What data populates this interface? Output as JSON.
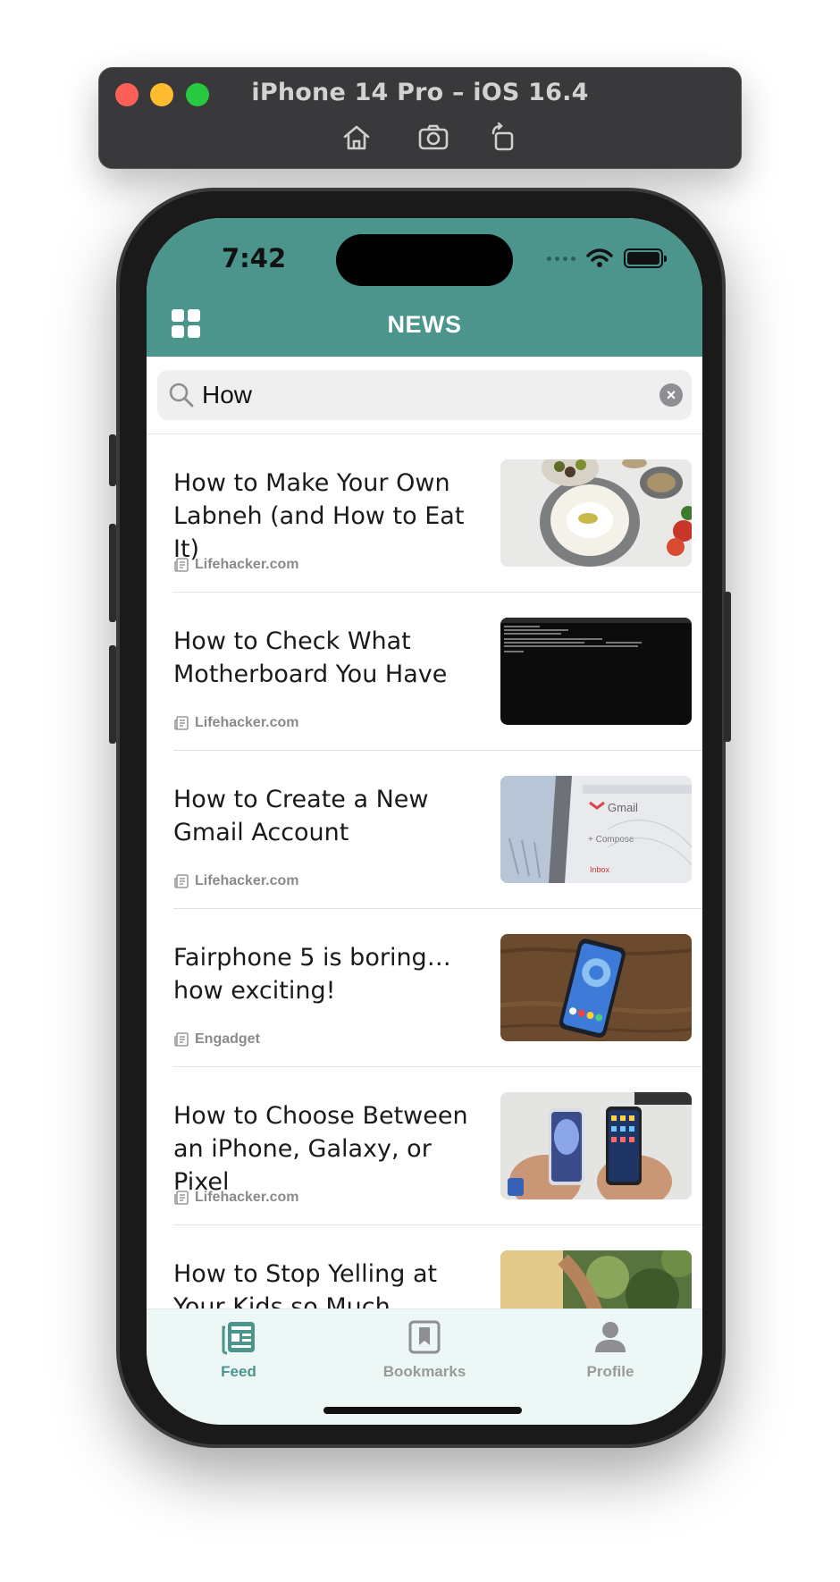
{
  "simulator": {
    "title": "iPhone 14 Pro – iOS 16.4",
    "buttons": [
      "home-icon",
      "screenshot-icon",
      "rotate-icon"
    ]
  },
  "status_bar": {
    "time": "7:42"
  },
  "header": {
    "title": "NEWS",
    "menu_icon": "grid-icon",
    "color": "#4b958c"
  },
  "search": {
    "value": "How",
    "icon": "search-icon"
  },
  "articles": [
    {
      "title": "How to Make Your Own Labneh (and How to Eat It)",
      "source": "Lifehacker.com"
    },
    {
      "title": "How to Check What Motherboard You Have",
      "source": "Lifehacker.com"
    },
    {
      "title": "How to Create a New Gmail Account",
      "source": "Lifehacker.com"
    },
    {
      "title": "Fairphone 5 is boring… how exciting!",
      "source": "Engadget"
    },
    {
      "title": "How to Choose Between an iPhone, Galaxy, or Pixel",
      "source": "Lifehacker.com"
    },
    {
      "title": "How to Stop Yelling at Your Kids so Much",
      "source": ""
    }
  ],
  "tabbar": {
    "tabs": [
      {
        "label": "Feed",
        "icon": "feed-icon",
        "active": true
      },
      {
        "label": "Bookmarks",
        "icon": "bookmark-icon",
        "active": false
      },
      {
        "label": "Profile",
        "icon": "profile-icon",
        "active": false
      }
    ],
    "active_color": "#4b958c",
    "inactive_color": "#9a9a9a"
  }
}
